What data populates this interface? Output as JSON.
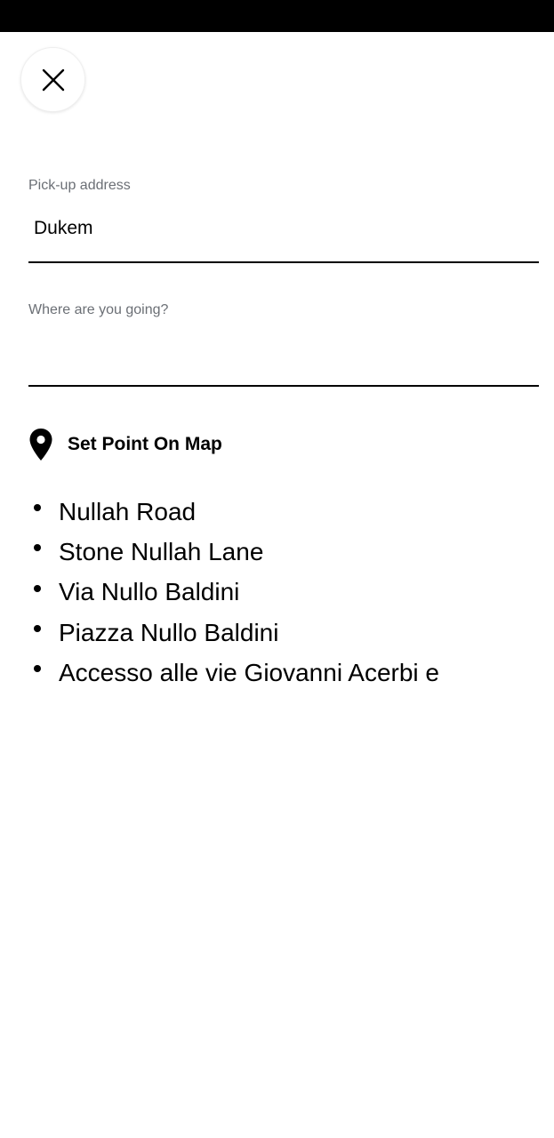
{
  "header": {
    "close_icon": "close-icon"
  },
  "pickup": {
    "label": "Pick-up address",
    "value": "Dukem"
  },
  "destination": {
    "label": "Where are you going?",
    "value": "",
    "placeholder": ""
  },
  "set_point": {
    "icon": "map-pin-icon",
    "label": "Set Point On Map"
  },
  "suggestions": [
    {
      "label": "Nullah Road"
    },
    {
      "label": "Stone Nullah Lane"
    },
    {
      "label": "Via Nullo Baldini"
    },
    {
      "label": "Piazza Nullo Baldini"
    },
    {
      "label": "Accesso alle vie Giovanni Acerbi e"
    }
  ],
  "colors": {
    "status_bar": "#000000",
    "label_gray": "#6b6f75",
    "text": "#000000",
    "background": "#ffffff"
  }
}
